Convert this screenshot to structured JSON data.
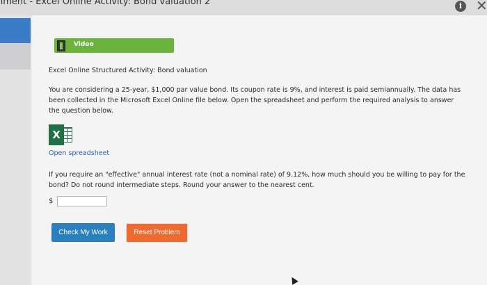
{
  "window": {
    "title": "nment - Excel Online Activity: Bond valuation 2",
    "info_icon": "i",
    "close_icon": "✕"
  },
  "video": {
    "icon": "film-icon",
    "label": "Video",
    "color": "#6bb43c"
  },
  "activity": {
    "heading": "Excel Online Structured Activity: Bond valuation",
    "description": "You are considering a 25-year, $1,000 par value bond. Its coupon rate is 9%, and interest is paid semiannually. The data has been collected in the Microsoft Excel Online file below. Open the spreadsheet and perform the required analysis to answer the question below.",
    "spreadsheet_icon": "excel-icon",
    "spreadsheet_icon_letter": "X",
    "open_link": "Open spreadsheet",
    "question": "If you require an \"effective\" annual interest rate (not a nominal rate) of 9.12%, how much should you be willing to pay for the bond? Do not round intermediate steps. Round your answer to the nearest cent.",
    "currency_symbol": "$",
    "answer_value": ""
  },
  "buttons": {
    "check": "Check My Work",
    "reset": "Reset Problem",
    "check_color": "#2a7fc1",
    "reset_color": "#ef6a2f"
  }
}
